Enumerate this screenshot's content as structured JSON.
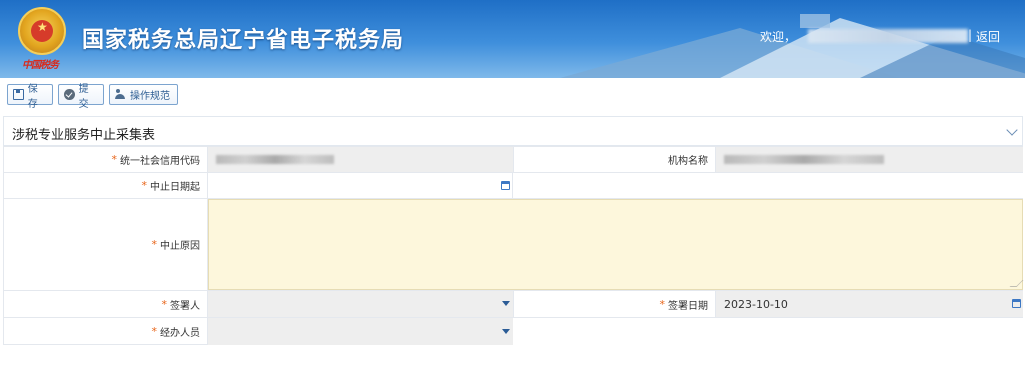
{
  "header": {
    "site_title": "国家税务总局辽宁省电子税务局",
    "emblem_text": "中国税务",
    "welcome": "欢迎，",
    "separator": "|",
    "back_link": "返回"
  },
  "toolbar": {
    "save_label": "保存",
    "submit_label": "提交",
    "guide_label": "操作规范"
  },
  "form": {
    "title": "涉税专业服务中止采集表",
    "required_mark": "*",
    "fields": {
      "credit_code_label": "统一社会信用代码",
      "org_name_label": "机构名称",
      "stop_date_label": "中止日期起",
      "stop_date_value": "",
      "stop_reason_label": "中止原因",
      "stop_reason_value": "",
      "signer_label": "签署人",
      "signer_value": "",
      "sign_date_label": "签署日期",
      "sign_date_value": "2023-10-10",
      "handler_label": "经办人员",
      "handler_value": ""
    }
  },
  "colors": {
    "required": "#e8651a",
    "accent": "#2f5f94",
    "readonly_bg": "#eeeeee",
    "textarea_bg": "#fdf7dc"
  }
}
